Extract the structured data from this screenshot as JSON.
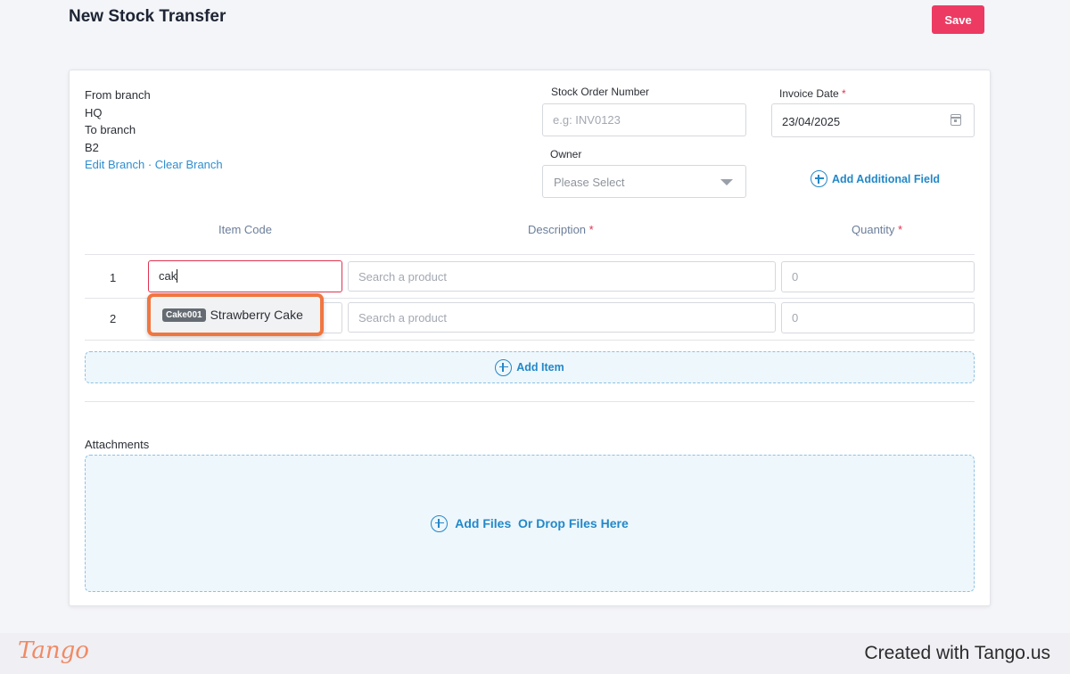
{
  "header": {
    "title": "New Stock Transfer",
    "save_label": "Save"
  },
  "branch": {
    "from_label": "From branch",
    "from_value": "HQ",
    "to_label": "To branch",
    "to_value": "B2",
    "edit_link": "Edit Branch",
    "separator": " · ",
    "clear_link": "Clear Branch"
  },
  "stock_order": {
    "label": "Stock Order Number",
    "placeholder": "e.g: INV0123",
    "value": ""
  },
  "invoice_date": {
    "label": "Invoice Date",
    "required_mark": "*",
    "value": "23/04/2025"
  },
  "owner": {
    "label": "Owner",
    "placeholder": "Please Select"
  },
  "add_field_label": "Add Additional Field",
  "table": {
    "columns": {
      "item_code": "Item Code",
      "description": "Description",
      "description_required": "*",
      "quantity": "Quantity",
      "quantity_required": "*"
    },
    "rows": [
      {
        "number": "1",
        "item_code": "cak",
        "description_placeholder": "Search a product",
        "quantity_placeholder": "0"
      },
      {
        "number": "2",
        "item_code": "",
        "description_placeholder": "Search a product",
        "quantity_placeholder": "0"
      }
    ]
  },
  "suggestion": {
    "code": "Cake001",
    "name": "Strawberry Cake"
  },
  "add_item_label": "Add Item",
  "attachments": {
    "label": "Attachments",
    "dropzone_text": "Add Files  Or Drop Files Here"
  },
  "footer": {
    "logo": "Tango",
    "credit": "Created with Tango.us"
  },
  "colors": {
    "accent": "#2388c8",
    "save": "#ec3a63",
    "highlight": "#f07640",
    "required": "#e0334f"
  }
}
